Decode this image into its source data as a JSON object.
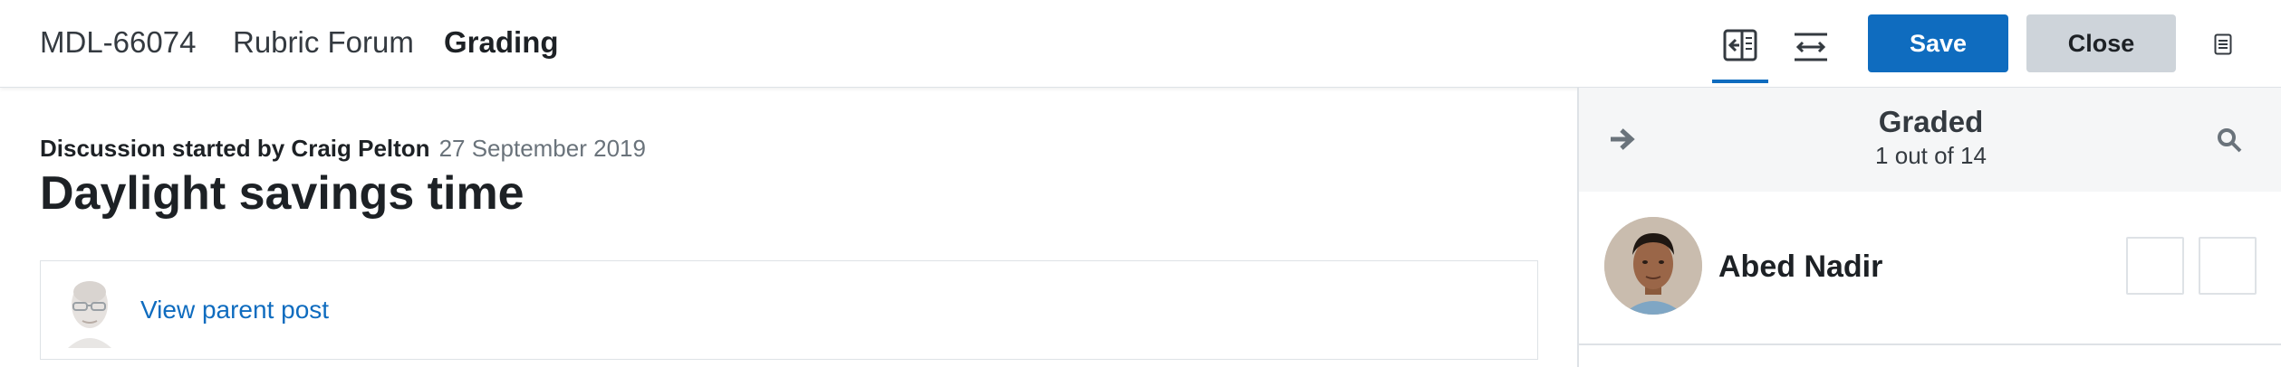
{
  "header": {
    "course_short_name": "MDL-66074",
    "forum_name": "Rubric Forum",
    "page_mode": "Grading",
    "collapse_icon": "collapse-grader-icon",
    "expand_icon": "expand-grader-icon",
    "save_label": "Save",
    "close_label": "Close",
    "info_icon": "info-document-icon"
  },
  "discussion": {
    "started_by": "Discussion started by Craig Pelton",
    "date": "27 September 2019",
    "title": "Daylight savings time",
    "parent_post_link": "View parent post"
  },
  "grader": {
    "status_label": "Graded",
    "status_count": "1 out of 14",
    "user_name": "Abed Nadir"
  },
  "colors": {
    "primary": "#0f6cbf",
    "secondary_button": "#ced4da",
    "panel_background": "#f5f6f7",
    "border": "#dee2e6"
  }
}
